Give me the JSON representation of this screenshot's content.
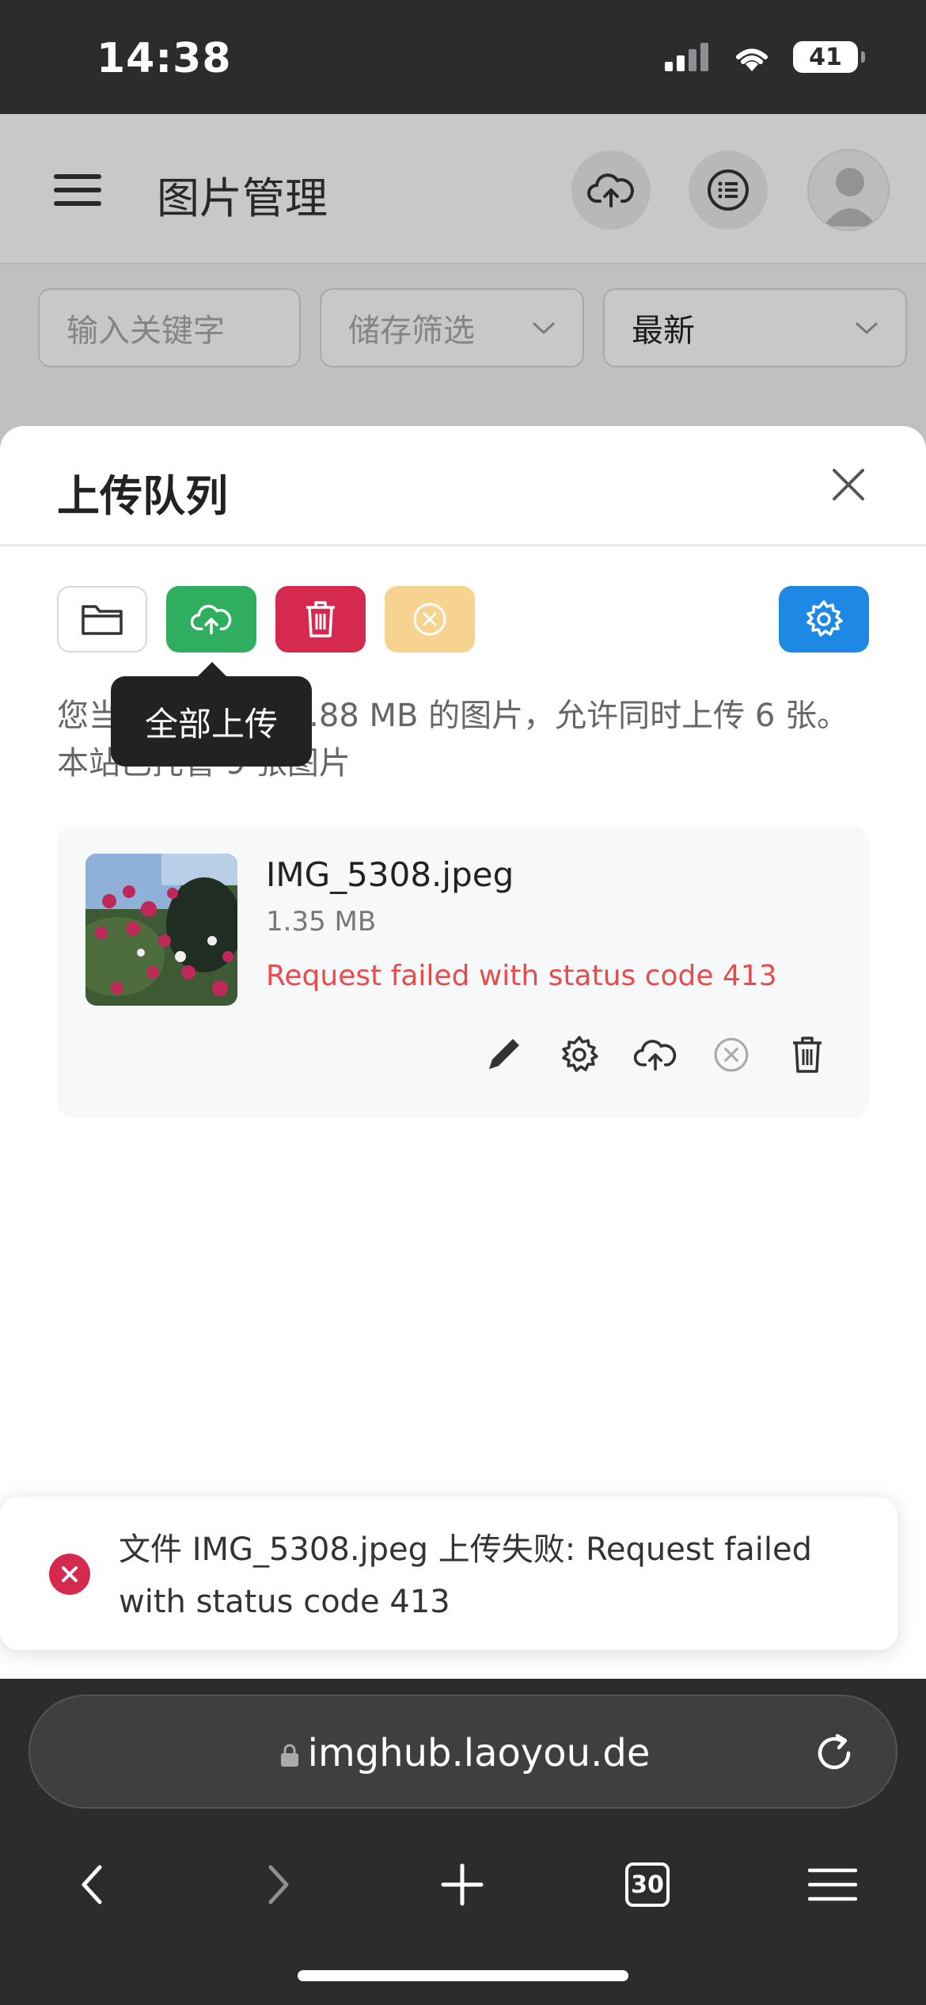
{
  "status_bar": {
    "time": "14:38",
    "battery": "41",
    "icons": [
      "signal-icon",
      "wifi-icon",
      "battery-icon"
    ]
  },
  "app": {
    "title": "图片管理",
    "icons": [
      "menu-icon",
      "cloud-upload-icon",
      "list-icon",
      "avatar-icon"
    ]
  },
  "filters": {
    "keyword_placeholder": "输入关键字",
    "storage_placeholder": "储存筛选",
    "sort_value": "最新"
  },
  "sheet": {
    "title": "上传队列",
    "toolbar": {
      "buttons": [
        "folder-icon",
        "cloud-upload-icon",
        "trash-icon",
        "cancel-icon",
        "gear-icon"
      ],
      "colors": {
        "upload": "#2fae5f",
        "delete": "#d6294f",
        "cancel": "#f6d38f",
        "settings": "#1e88e5"
      }
    },
    "tooltip": "全部上传",
    "info": "您当前可以上传 9.88 MB 的图片，允许同时上传 6 张。本站已托管 9 张图片",
    "file": {
      "name": "IMG_5308.jpeg",
      "size": "1.35 MB",
      "error": "Request failed with status code 413",
      "actions": [
        "edit-icon",
        "gear-icon",
        "cloud-upload-icon",
        "cancel-icon",
        "trash-icon"
      ]
    }
  },
  "toast": {
    "message": "文件 IMG_5308.jpeg 上传失败: Request failed with status code 413"
  },
  "browser": {
    "url": "imghub.laoyou.de",
    "tabs_count": "30"
  }
}
